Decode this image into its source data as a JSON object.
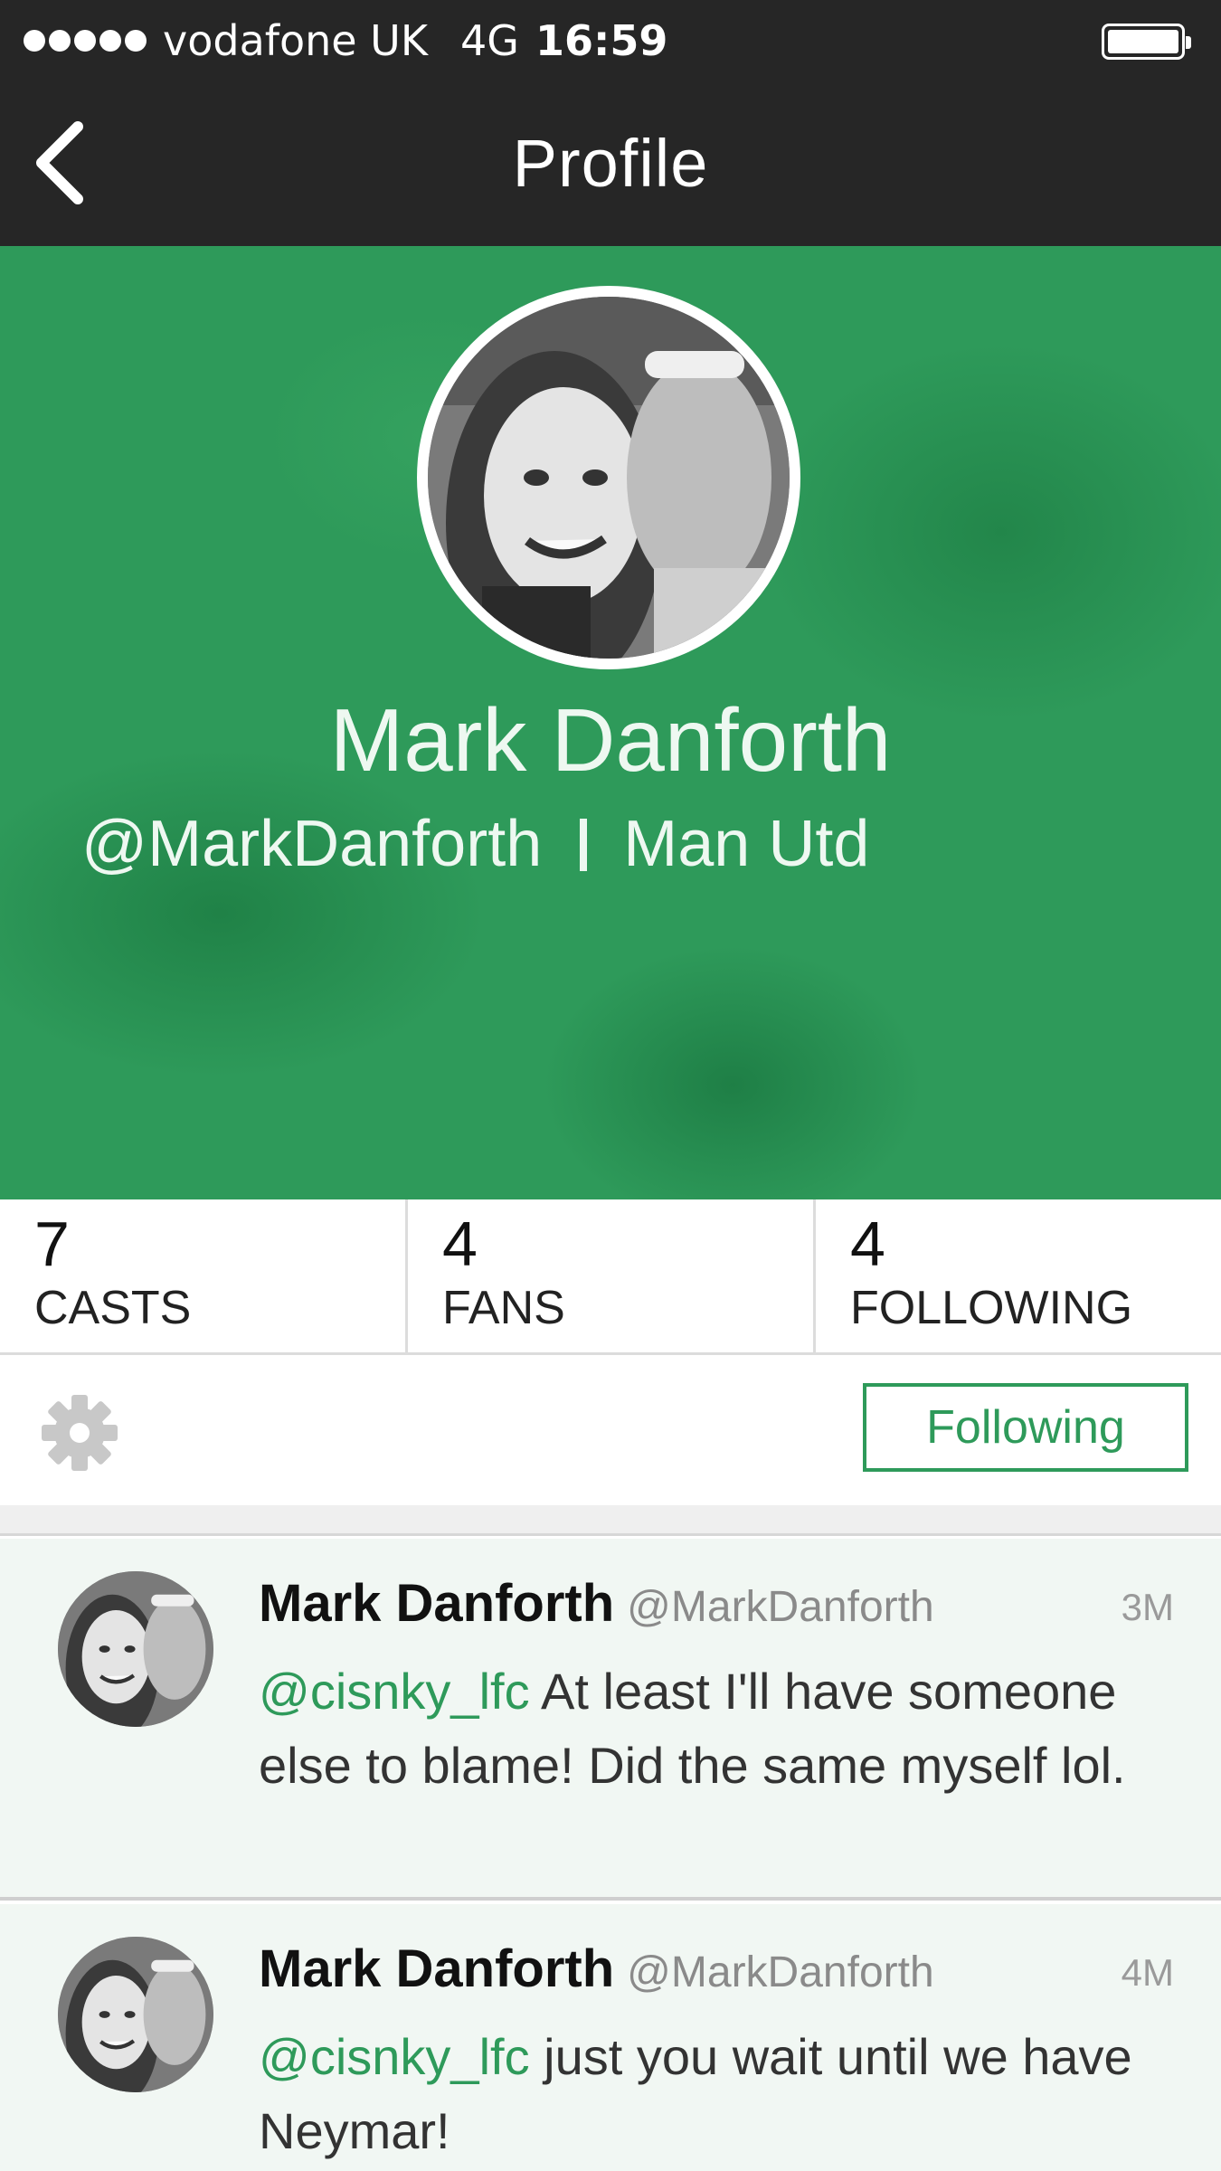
{
  "status_bar": {
    "carrier": "vodafone UK",
    "network": "4G",
    "time": "16:59"
  },
  "nav": {
    "title": "Profile",
    "back_icon": "chevron-left-icon"
  },
  "profile": {
    "name": "Mark Danforth",
    "handle": "@MarkDanforth",
    "team": "Man Utd",
    "accent_color": "#2e9a5a"
  },
  "stats": [
    {
      "value": "7",
      "label": "CASTS"
    },
    {
      "value": "4",
      "label": "FANS"
    },
    {
      "value": "4",
      "label": "FOLLOWING"
    }
  ],
  "actions": {
    "settings_icon": "gear-icon",
    "follow_label": "Following"
  },
  "casts": [
    {
      "name": "Mark Danforth",
      "handle": "@MarkDanforth",
      "time": "3M",
      "mention": "@cisnky_lfc",
      "text": " At least I'll have someone else to blame! Did the same myself lol."
    },
    {
      "name": "Mark Danforth",
      "handle": "@MarkDanforth",
      "time": "4M",
      "mention": "@cisnky_lfc",
      "text": " just you wait until we have Neymar!"
    }
  ]
}
